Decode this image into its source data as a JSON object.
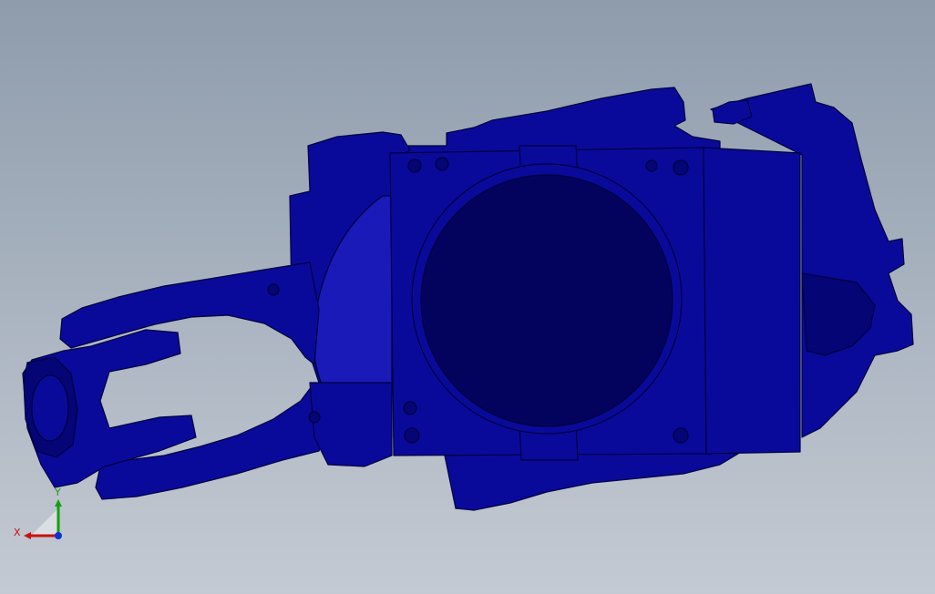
{
  "viewport": {
    "background_top": "#8e9cac",
    "background_bottom": "#c4cad3"
  },
  "model": {
    "color_fill": "#0a0a9a",
    "color_dark": "#03035e",
    "color_edge": "#000040",
    "color_light": "#1a1ab8"
  },
  "triad": {
    "x_label": "X",
    "y_label": "Y",
    "x_color": "#c81010",
    "y_color": "#10a010",
    "z_color": "#1030d0"
  }
}
